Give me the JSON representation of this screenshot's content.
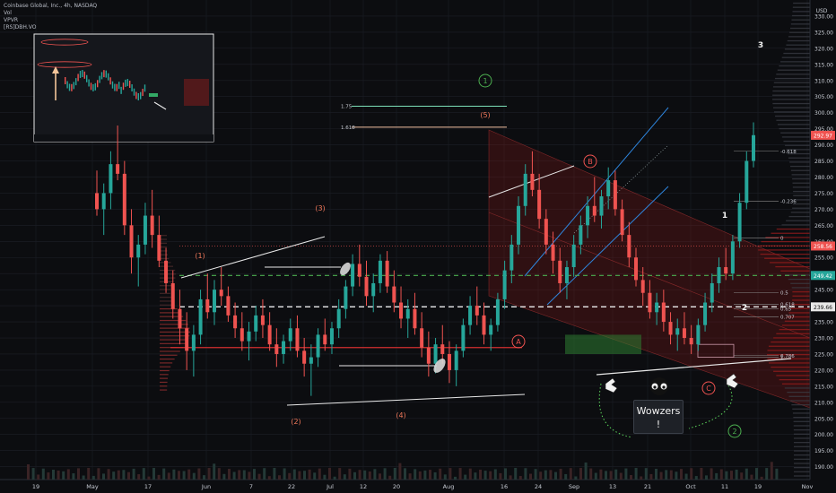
{
  "header": {
    "symbol_line": "Coinbase Global, Inc., 4h, NASDAQ",
    "indicators": [
      "Vol",
      "VPVR",
      "[RS]DBH.VO"
    ]
  },
  "top_right_label": "USD",
  "colors": {
    "bg": "#0c0d10",
    "up": "#26a69a",
    "down": "#ef5350",
    "grid": "#1c1f26",
    "white_line": "#e8e8e8",
    "blue_line": "#2e86de",
    "green_dash": "#4caf50",
    "red_line": "#d32f2f",
    "label_red": "#f0785a",
    "label_green": "#4caf50"
  },
  "chart_data": {
    "type": "candlestick",
    "ylim": [
      186,
      335
    ],
    "y_ticks": [
      190,
      195,
      200,
      205,
      210,
      215,
      220,
      225,
      230,
      235,
      240,
      245,
      250,
      255,
      260,
      265,
      270,
      275,
      280,
      285,
      290,
      295,
      300,
      305,
      310,
      315,
      320,
      325,
      330
    ],
    "x_ticks": [
      "19",
      "May",
      "17",
      "Jun",
      "7",
      "22",
      "Jul",
      "12",
      "20",
      "Aug",
      "16",
      "24",
      "Sep",
      "13",
      "21",
      "Oct",
      "11",
      "19",
      "Nov"
    ],
    "price_tags": [
      {
        "value": 292.97,
        "label": "292.97",
        "color": "#ef5350"
      },
      {
        "value": 258.56,
        "label": "258.56",
        "color": "#ef5350"
      },
      {
        "value": 249.42,
        "label": "249.42",
        "color": "#26a69a"
      },
      {
        "value": 239.66,
        "label": "239.66",
        "color": "#e8e8e8"
      }
    ],
    "fib_levels": [
      {
        "label": "1.75",
        "value": 302
      },
      {
        "label": "1.618",
        "value": 295.5
      },
      {
        "label": "-0.618",
        "value": 288
      },
      {
        "label": "-0.236",
        "value": 272.5
      },
      {
        "label": "0",
        "value": 261
      },
      {
        "label": "0.5",
        "value": 244
      },
      {
        "label": "0.618",
        "value": 240.5
      },
      {
        "label": "0.65",
        "value": 239
      },
      {
        "label": "0.707",
        "value": 236.5
      },
      {
        "label": "0.786",
        "value": 224.5
      },
      {
        "label": "1",
        "value": 224
      }
    ],
    "wave_labels": [
      {
        "text": "(1)",
        "kind": "red"
      },
      {
        "text": "(2)",
        "kind": "red"
      },
      {
        "text": "(3)",
        "kind": "red"
      },
      {
        "text": "(4)",
        "kind": "red"
      },
      {
        "text": "(5)",
        "kind": "red"
      },
      {
        "text": "A",
        "kind": "circle-red"
      },
      {
        "text": "B",
        "kind": "circle-red"
      },
      {
        "text": "C",
        "kind": "circle-red"
      },
      {
        "text": "1",
        "kind": "circle-green"
      },
      {
        "text": "2",
        "kind": "circle-green"
      },
      {
        "text": "1",
        "kind": "white"
      },
      {
        "text": "2",
        "kind": "white"
      },
      {
        "text": "3",
        "kind": "white"
      }
    ],
    "candles": [
      [
        275,
        282,
        268,
        270
      ],
      [
        270,
        278,
        262,
        275
      ],
      [
        275,
        288,
        270,
        284
      ],
      [
        284,
        296,
        279,
        281
      ],
      [
        281,
        285,
        262,
        265
      ],
      [
        265,
        270,
        250,
        255
      ],
      [
        255,
        262,
        246,
        259
      ],
      [
        259,
        272,
        256,
        268
      ],
      [
        268,
        276,
        258,
        262
      ],
      [
        262,
        268,
        252,
        254
      ],
      [
        254,
        258,
        244,
        247
      ],
      [
        247,
        251,
        236,
        239
      ],
      [
        239,
        245,
        228,
        233
      ],
      [
        233,
        238,
        220,
        226
      ],
      [
        226,
        234,
        218,
        231
      ],
      [
        231,
        245,
        228,
        242
      ],
      [
        242,
        250,
        236,
        238
      ],
      [
        238,
        248,
        234,
        245
      ],
      [
        245,
        252,
        240,
        243
      ],
      [
        243,
        246,
        235,
        237
      ],
      [
        237,
        241,
        230,
        233
      ],
      [
        233,
        238,
        226,
        229
      ],
      [
        229,
        235,
        223,
        232
      ],
      [
        232,
        240,
        229,
        237
      ],
      [
        237,
        242,
        230,
        234
      ],
      [
        234,
        238,
        226,
        228
      ],
      [
        228,
        233,
        221,
        225
      ],
      [
        225,
        231,
        222,
        229
      ],
      [
        229,
        236,
        226,
        233
      ],
      [
        233,
        237,
        224,
        226
      ],
      [
        226,
        230,
        218,
        222
      ],
      [
        222,
        228,
        212,
        224
      ],
      [
        224,
        233,
        221,
        231
      ],
      [
        231,
        236,
        226,
        228
      ],
      [
        228,
        235,
        225,
        233
      ],
      [
        233,
        242,
        230,
        239
      ],
      [
        239,
        248,
        236,
        246
      ],
      [
        246,
        256,
        243,
        253
      ],
      [
        253,
        259,
        246,
        249
      ],
      [
        249,
        254,
        240,
        243
      ],
      [
        243,
        250,
        238,
        247
      ],
      [
        247,
        256,
        244,
        254
      ],
      [
        254,
        257,
        244,
        246
      ],
      [
        246,
        251,
        238,
        241
      ],
      [
        241,
        246,
        233,
        236
      ],
      [
        236,
        242,
        230,
        239
      ],
      [
        239,
        244,
        231,
        233
      ],
      [
        233,
        238,
        224,
        227
      ],
      [
        227,
        232,
        218,
        222
      ],
      [
        222,
        230,
        219,
        228
      ],
      [
        228,
        234,
        222,
        225
      ],
      [
        225,
        229,
        216,
        220
      ],
      [
        220,
        228,
        215,
        226
      ],
      [
        226,
        236,
        224,
        234
      ],
      [
        234,
        243,
        231,
        240
      ],
      [
        240,
        246,
        234,
        237
      ],
      [
        237,
        241,
        228,
        231
      ],
      [
        231,
        236,
        226,
        234
      ],
      [
        234,
        244,
        232,
        242
      ],
      [
        242,
        254,
        239,
        251
      ],
      [
        251,
        262,
        247,
        259
      ],
      [
        259,
        274,
        256,
        271
      ],
      [
        271,
        284,
        268,
        281
      ],
      [
        281,
        288,
        274,
        276
      ],
      [
        276,
        281,
        264,
        267
      ],
      [
        267,
        270,
        256,
        259
      ],
      [
        259,
        263,
        250,
        254
      ],
      [
        254,
        258,
        244,
        247
      ],
      [
        247,
        254,
        242,
        252
      ],
      [
        252,
        262,
        249,
        259
      ],
      [
        259,
        268,
        256,
        265
      ],
      [
        265,
        274,
        261,
        271
      ],
      [
        271,
        280,
        266,
        268
      ],
      [
        268,
        276,
        264,
        274
      ],
      [
        274,
        283,
        270,
        279
      ],
      [
        279,
        282,
        268,
        270
      ],
      [
        270,
        273,
        260,
        262
      ],
      [
        262,
        266,
        252,
        255
      ],
      [
        255,
        258,
        246,
        248
      ],
      [
        248,
        252,
        240,
        244
      ],
      [
        244,
        248,
        236,
        238
      ],
      [
        238,
        244,
        234,
        241
      ],
      [
        241,
        245,
        232,
        235
      ],
      [
        235,
        238,
        228,
        231
      ],
      [
        231,
        236,
        226,
        233
      ],
      [
        233,
        238,
        228,
        230
      ],
      [
        230,
        234,
        225,
        228
      ],
      [
        228,
        236,
        226,
        234
      ],
      [
        234,
        244,
        232,
        241
      ],
      [
        241,
        250,
        238,
        247
      ],
      [
        247,
        255,
        244,
        252
      ],
      [
        252,
        258,
        248,
        250
      ],
      [
        250,
        262,
        248,
        260
      ],
      [
        260,
        275,
        258,
        272
      ],
      [
        272,
        288,
        270,
        285
      ],
      [
        285,
        297,
        283,
        293
      ]
    ]
  }
}
